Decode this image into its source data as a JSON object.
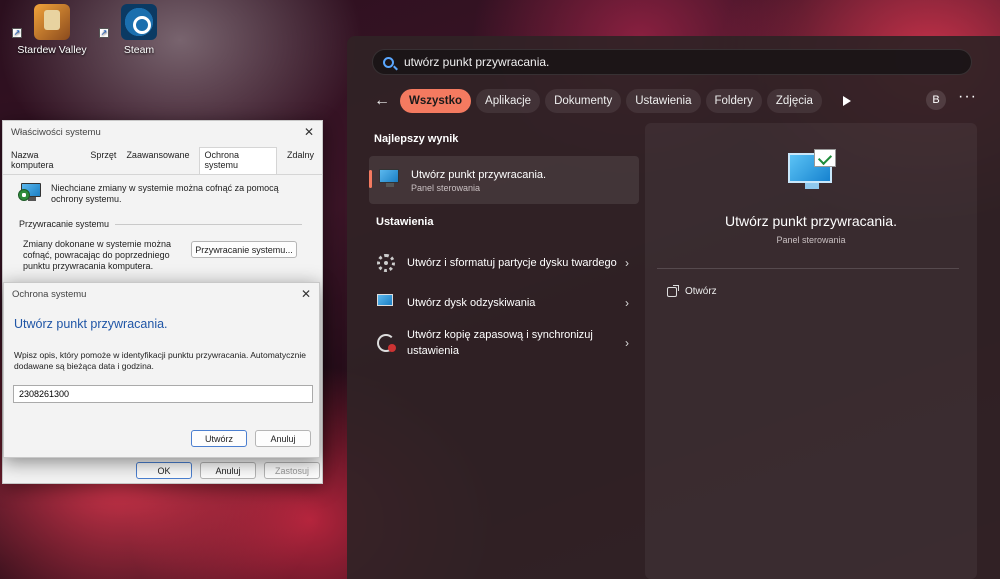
{
  "desktop": {
    "icons": [
      {
        "label": "Stardew Valley",
        "icon": "stardew-valley-icon"
      },
      {
        "label": "Steam",
        "icon": "steam-icon"
      }
    ]
  },
  "system_props": {
    "title": "Właściwości systemu",
    "tabs": [
      "Nazwa komputera",
      "Sprzęt",
      "Zaawansowane",
      "Ochrona systemu",
      "Zdalny"
    ],
    "active_tab": "Ochrona systemu",
    "intro": "Niechciane zmiany w systemie można cofnąć za pomocą ochrony systemu.",
    "restore_group": "Przywracanie systemu",
    "restore_text": "Zmiany dokonane w systemie można cofnąć, powracając do poprzedniego punktu przywracania komputera.",
    "restore_button": "Przywracanie systemu...",
    "ok": "OK",
    "cancel": "Anuluj",
    "apply": "Zastosuj"
  },
  "protection_dialog": {
    "title": "Ochrona systemu",
    "heading": "Utwórz punkt przywracania.",
    "description": "Wpisz opis, który pomoże w identyfikacji punktu przywracania. Automatycznie dodawane są bieżąca data i godzina.",
    "input_value": "2308261300",
    "create": "Utwórz",
    "cancel": "Anuluj"
  },
  "search": {
    "query": "utwórz punkt przywracania.",
    "filters": [
      "Wszystko",
      "Aplikacje",
      "Dokumenty",
      "Ustawienia",
      "Foldery",
      "Zdjęcia"
    ],
    "active_filter": "Wszystko",
    "avatar": "B",
    "best_match_title": "Najlepszy wynik",
    "best_match": {
      "title": "Utwórz punkt przywracania.",
      "subtitle": "Panel sterowania"
    },
    "settings_title": "Ustawienia",
    "settings": [
      {
        "label": "Utwórz i sformatuj partycje dysku twardego",
        "icon": "gear-icon"
      },
      {
        "label": "Utwórz dysk odzyskiwania",
        "icon": "monitor-icon"
      },
      {
        "label": "Utwórz kopię zapasową i synchronizuj ustawienia",
        "icon": "sync-icon"
      }
    ],
    "preview": {
      "title": "Utwórz punkt przywracania.",
      "subtitle": "Panel sterowania",
      "open": "Otwórz"
    }
  }
}
